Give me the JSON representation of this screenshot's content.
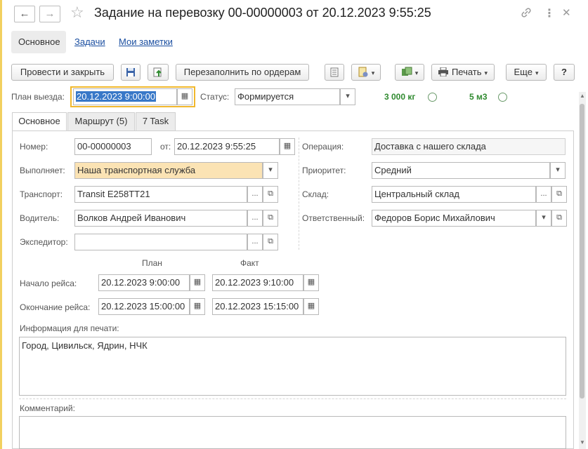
{
  "window": {
    "title": "Задание на перевозку 00-00000003 от 20.12.2023 9:55:25"
  },
  "section_tabs": [
    {
      "label": "Основное",
      "active": true
    },
    {
      "label": "Задачи",
      "active": false
    },
    {
      "label": "Мои заметки",
      "active": false
    }
  ],
  "toolbar": {
    "post_close": "Провести и закрыть",
    "refill": "Перезаполнить по ордерам",
    "print": "Печать",
    "more": "Еще",
    "help": "?"
  },
  "plan_departure": {
    "label": "План выезда:",
    "value": "20.12.2023  9:00:00"
  },
  "status": {
    "label": "Статус:",
    "value": "Формируется"
  },
  "weight": "3 000 кг",
  "volume": "5 м3",
  "inner_tabs": [
    {
      "label": "Основное",
      "active": true
    },
    {
      "label": "Маршрут (5)",
      "active": false
    },
    {
      "label": "7 Task",
      "active": false
    }
  ],
  "form": {
    "number": {
      "label": "Номер:",
      "value": "00-00000003"
    },
    "date": {
      "label": "от:",
      "value": "20.12.2023  9:55:25"
    },
    "operation": {
      "label": "Операция:",
      "value": "Доставка с нашего склада"
    },
    "executor": {
      "label": "Выполняет:",
      "value": "Наша транспортная служба"
    },
    "priority": {
      "label": "Приоритет:",
      "value": "Средний"
    },
    "transport": {
      "label": "Транспорт:",
      "value": "Transit Е258ТТ21"
    },
    "warehouse": {
      "label": "Склад:",
      "value": "Центральный склад"
    },
    "driver": {
      "label": "Водитель:",
      "value": "Волков Андрей Иванович"
    },
    "responsible": {
      "label": "Ответственный:",
      "value": "Федоров Борис Михайлович"
    },
    "forwarder": {
      "label": "Экспедитор:",
      "value": ""
    }
  },
  "trip": {
    "plan_header": "План",
    "fact_header": "Факт",
    "start_label": "Начало рейса:",
    "start_plan": "20.12.2023  9:00:00",
    "start_fact": "20.12.2023  9:10:00",
    "end_label": "Окончание рейса:",
    "end_plan": "20.12.2023 15:00:00",
    "end_fact": "20.12.2023 15:15:00"
  },
  "print_info": {
    "label": "Информация для печати:",
    "value": "Город, Цивильск, Ядрин, НЧК"
  },
  "comment": {
    "label": "Комментарий:",
    "value": ""
  },
  "icons": {
    "back": "←",
    "forward": "→",
    "star": "☆",
    "link": "🔗",
    "menu": "⋮",
    "close": "✕",
    "calendar": "▦",
    "dropdown": "▾",
    "dots": "...",
    "open": "⧉",
    "print": "⎙"
  },
  "colors": {
    "accent_yellow": "#f1b82d",
    "ok_green": "#2f8a2f",
    "link_blue": "#1a4ea0",
    "field_yellow": "#fbe3b4"
  }
}
